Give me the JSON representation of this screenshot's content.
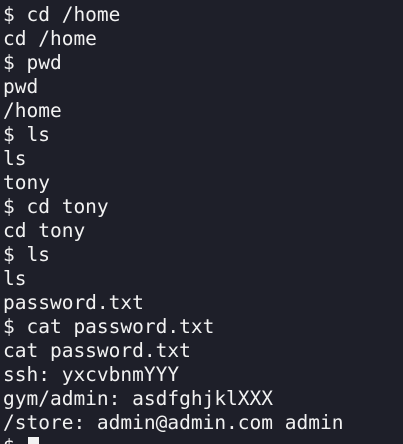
{
  "terminal": {
    "lines": [
      "$ cd /home",
      "cd /home",
      "$ pwd",
      "pwd",
      "/home",
      "$ ls",
      "ls",
      "tony",
      "$ cd tony",
      "cd tony",
      "$ ls",
      "ls",
      "password.txt",
      "$ cat password.txt",
      "cat password.txt",
      "ssh: yxcvbnmYYY",
      "gym/admin: asdfghjklXXX",
      "/store: admin@admin.com admin"
    ],
    "current_prompt": "$ "
  }
}
